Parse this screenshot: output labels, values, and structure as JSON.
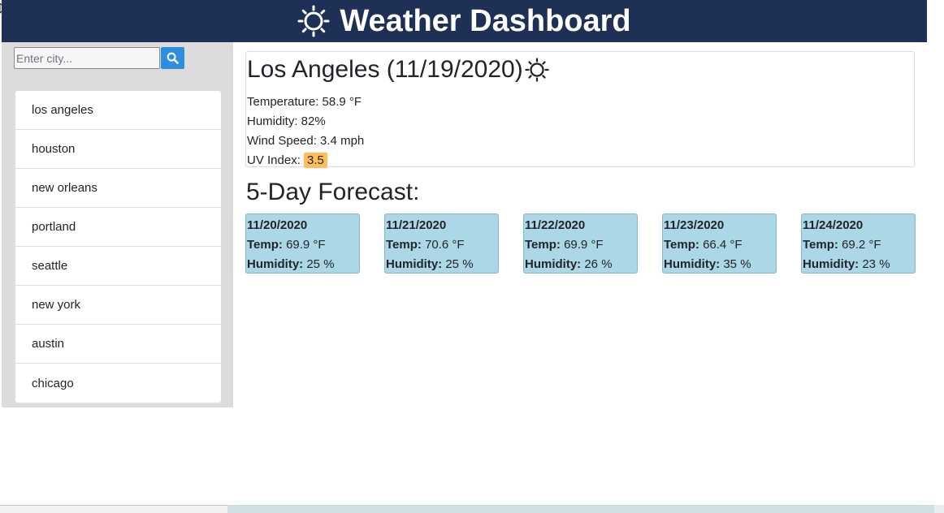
{
  "header": {
    "title": "Weather Dashboard",
    "icon": "sun-icon"
  },
  "search": {
    "placeholder": "Enter city...",
    "value": "",
    "button_icon": "search-icon"
  },
  "cities": [
    "los angeles",
    "houston",
    "new orleans",
    "portland",
    "seattle",
    "new york",
    "austin",
    "chicago"
  ],
  "current": {
    "title": "Los Angeles (11/19/2020)",
    "icon": "sun-icon",
    "temperature": "Temperature: 58.9 °F",
    "humidity": "Humidity: 82%",
    "wind": "Wind Speed: 3.4 mph",
    "uv_label": "UV Index:",
    "uv_value": "3.5",
    "uv_color": "#ffbe5c"
  },
  "forecast": {
    "title": "5-Day Forecast:",
    "temp_label": "Temp:",
    "humidity_label": "Humidity:",
    "days": [
      {
        "date": "11/20/2020",
        "temp": "69.9 °F",
        "humidity": "25 %"
      },
      {
        "date": "11/21/2020",
        "temp": "70.6 °F",
        "humidity": "25 %"
      },
      {
        "date": "11/22/2020",
        "temp": "69.9 °F",
        "humidity": "26 %"
      },
      {
        "date": "11/23/2020",
        "temp": "66.4 °F",
        "humidity": "35 %"
      },
      {
        "date": "11/24/2020",
        "temp": "69.2 °F",
        "humidity": "23 %"
      }
    ]
  },
  "colors": {
    "header_bg": "#1f3057",
    "card_bg": "#abd7e6",
    "search_button": "#2d8ee0"
  }
}
